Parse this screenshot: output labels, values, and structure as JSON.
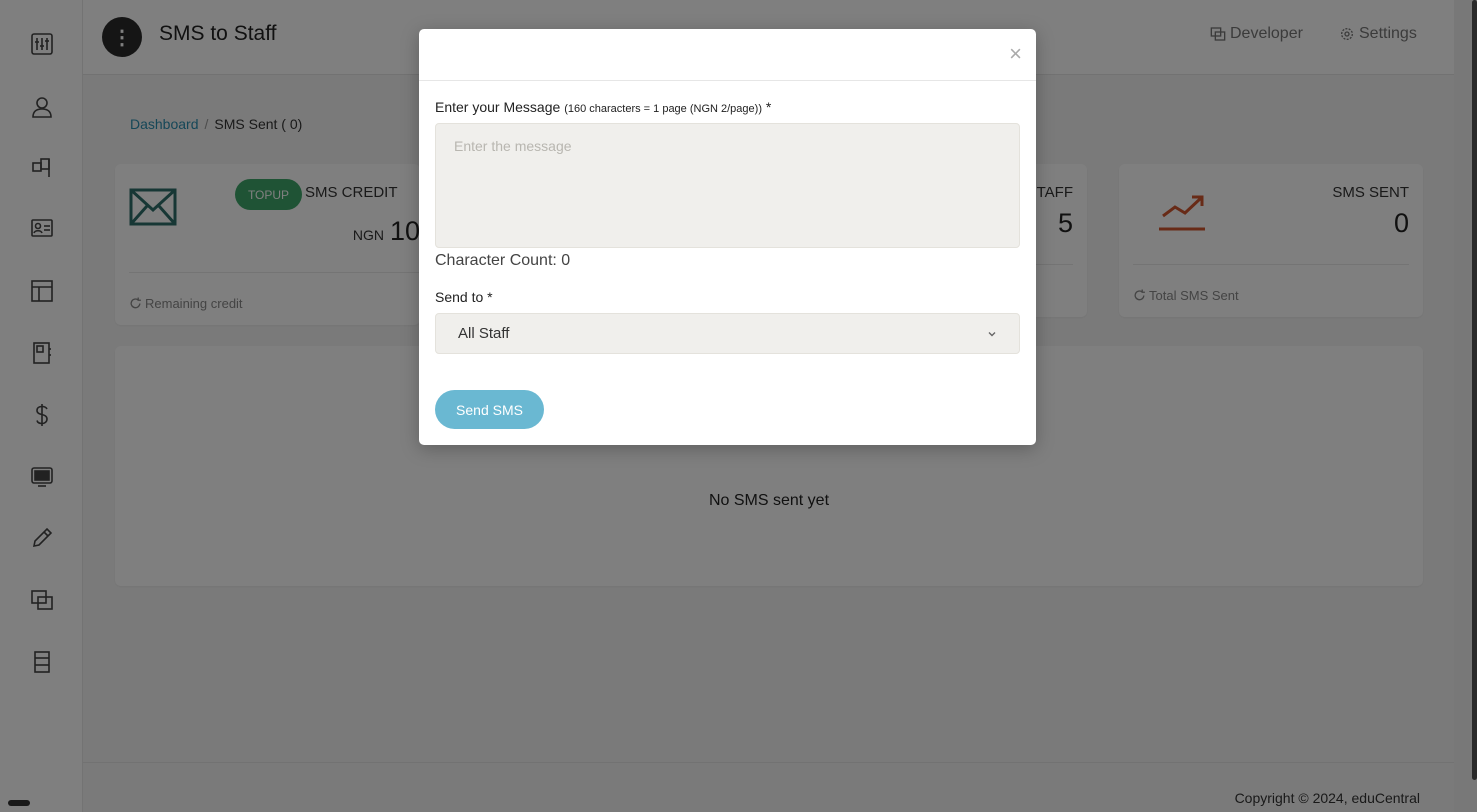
{
  "header": {
    "title": "SMS to Staff",
    "developer_label": "Developer",
    "settings_label": "Settings"
  },
  "breadcrumb": {
    "home": "Dashboard",
    "current": "SMS Sent ( 0)"
  },
  "cards": {
    "credit": {
      "topup_label": "TOPUP",
      "label": "SMS CREDIT",
      "currency": "NGN",
      "value": "10",
      "footer": "Remaining credit"
    },
    "staff": {
      "label_visible": "TAFF",
      "value": "5"
    },
    "sent": {
      "label": "SMS SENT",
      "value": "0",
      "footer": "Total SMS Sent"
    }
  },
  "empty_state": "No SMS sent yet",
  "footer": {
    "copyright": "Copyright © 2024, eduCentral"
  },
  "modal": {
    "message_label": "Enter your Message",
    "message_hint": "(160 characters = 1 page (NGN 2/page))",
    "required_mark": "*",
    "message_placeholder": "Enter the message",
    "char_count": "Character Count: 0",
    "send_to_label": "Send to *",
    "send_to_value": "All Staff",
    "submit_label": "Send SMS",
    "close_glyph": "×"
  },
  "icons": {
    "sidebar": [
      "sliders-icon",
      "user-icon",
      "flag-icon",
      "id-card-icon",
      "layout-icon",
      "notebook-icon",
      "dollar-icon",
      "monitor-icon",
      "pencil-icon",
      "copy-icon",
      "bookmark-icon"
    ]
  },
  "colors": {
    "topup": "#3fa66a",
    "link": "#2b8fb0",
    "send_button": "#6ab8d2",
    "sent_icon": "#d1562e",
    "mail_icon": "#2e6e6a"
  }
}
